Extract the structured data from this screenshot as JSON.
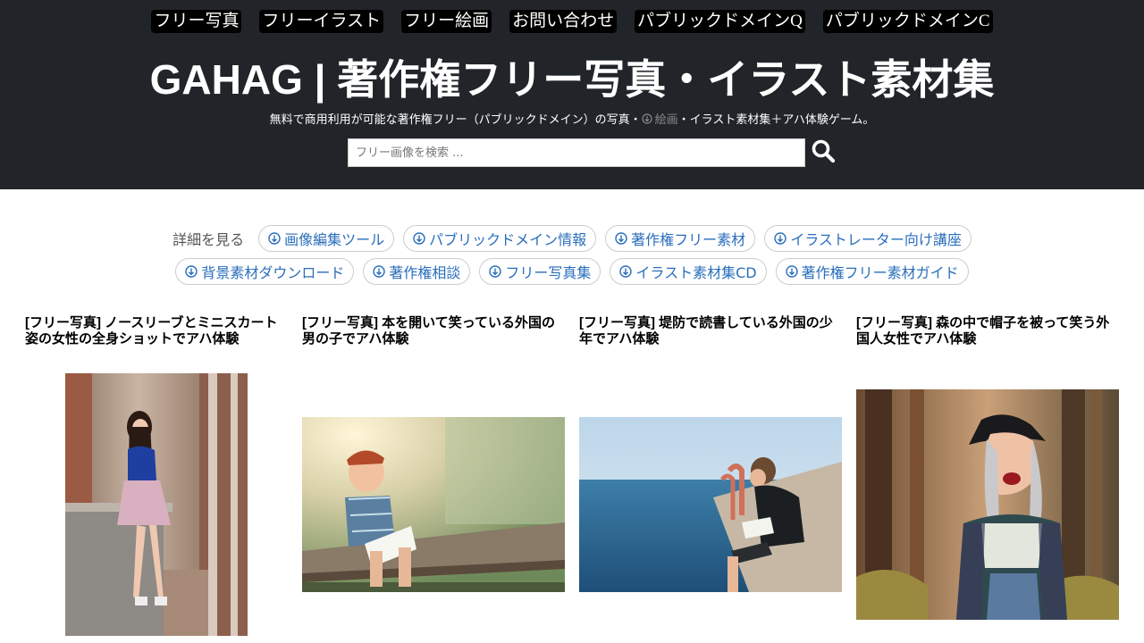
{
  "nav": {
    "items": [
      {
        "label": "フリー写真"
      },
      {
        "label": "フリーイラスト"
      },
      {
        "label": "フリー絵画"
      },
      {
        "label": "お問い合わせ"
      },
      {
        "label": "パブリックドメインQ"
      },
      {
        "label": "パブリックドメインC"
      }
    ]
  },
  "header": {
    "title": "GAHAG | 著作権フリー写真・イラスト素材集",
    "tagline_before": "無料で商用利用が可能な著作権フリー（パブリックドメイン）の写真・",
    "tagline_link": "絵画",
    "tagline_after": "・イラスト素材集＋アハ体験ゲーム。"
  },
  "search": {
    "placeholder": "フリー画像を検索 ...",
    "value": "",
    "icon": "search-icon"
  },
  "tags": {
    "lead": "詳細を見る",
    "row1": [
      {
        "label": "画像編集ツール"
      },
      {
        "label": "パブリックドメイン情報"
      },
      {
        "label": "著作権フリー素材"
      },
      {
        "label": "イラストレーター向け講座"
      }
    ],
    "row2": [
      {
        "label": "背景素材ダウンロード"
      },
      {
        "label": "著作権相談"
      },
      {
        "label": "フリー写真集"
      },
      {
        "label": "イラスト素材集CD"
      },
      {
        "label": "著作権フリー素材ガイド"
      }
    ]
  },
  "cards": [
    {
      "title": "[フリー写真] ノースリーブとミニスカート姿の女性の全身ショットでアハ体験"
    },
    {
      "title": "[フリー写真] 本を開いて笑っている外国の男の子でアハ体験"
    },
    {
      "title": "[フリー写真] 堤防で読書している外国の少年でアハ体験"
    },
    {
      "title": "[フリー写真] 森の中で帽子を被って笑う外国人女性でアハ体験"
    }
  ],
  "colors": {
    "header_bg": "#212529",
    "link": "#2a6ebb"
  }
}
